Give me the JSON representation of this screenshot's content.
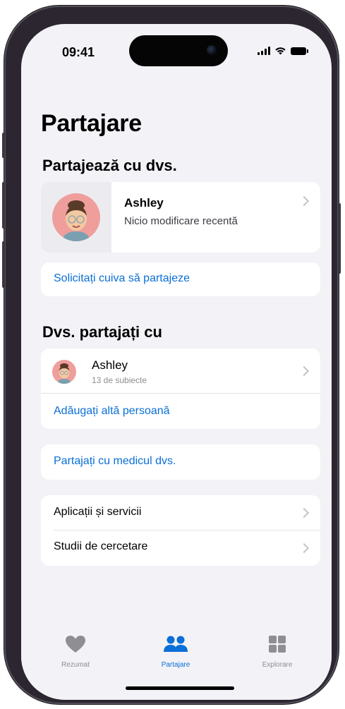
{
  "status_bar": {
    "time": "09:41",
    "signal_icon": "cellular-signal-icon",
    "wifi_icon": "wifi-icon",
    "battery_icon": "battery-icon"
  },
  "page": {
    "title": "Partajare"
  },
  "shared_with_you": {
    "heading": "Partajează cu dvs.",
    "person": {
      "name": "Ashley",
      "status": "Nicio modificare recentă",
      "avatar_icon": "memoji-avatar-icon"
    },
    "ask_link": "Solicitați cuiva să partajeze"
  },
  "you_share_with": {
    "heading": "Dvs. partajați cu",
    "person": {
      "name": "Ashley",
      "subtitle": "13 de subiecte",
      "avatar_icon": "memoji-avatar-icon"
    },
    "add_link": "Adăugați altă persoană"
  },
  "doctor": {
    "link": "Partajați cu medicul dvs."
  },
  "more": {
    "items": [
      {
        "label": "Aplicații și servicii"
      },
      {
        "label": "Studii de cercetare"
      }
    ]
  },
  "tab_bar": {
    "tabs": [
      {
        "label": "Rezumat",
        "icon": "heart-icon",
        "active": false
      },
      {
        "label": "Partajare",
        "icon": "people-icon",
        "active": true
      },
      {
        "label": "Explorare",
        "icon": "grid-icon",
        "active": false
      }
    ]
  },
  "colors": {
    "accent": "#0a6fd6",
    "background": "#f2f2f7",
    "card": "#ffffff",
    "inactive_tab": "#8e8e93"
  }
}
